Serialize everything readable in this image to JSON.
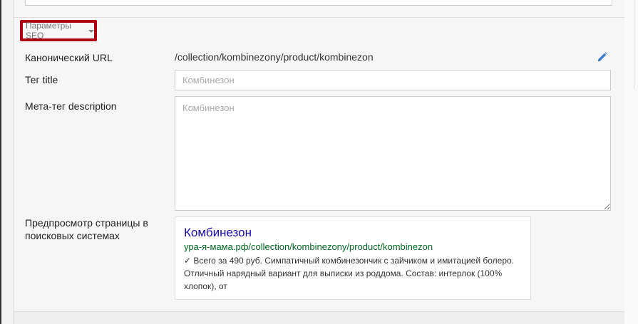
{
  "seo": {
    "toggle_label": "Параметры SEO",
    "canonical_label": "Канонический URL",
    "canonical_value": "/collection/kombinezony/product/kombinezon",
    "title_label": "Тег title",
    "title_placeholder": "Комбинезон",
    "description_label": "Мета-тег description",
    "description_placeholder": "Комбинезон",
    "preview_label": "Предпросмотр страницы в поисковых системах"
  },
  "preview": {
    "title": "Комбинезон",
    "url": "ура-я-мама.рф/collection/kombinezony/product/kombinezon",
    "description": "✓ Всего за 490 руб. Симпатичный комбинезончик с зайчиком и имитацией болеро. Отличный нарядный вариант для выписки из роддома. Состав: интерлок (100% хлопок), от"
  },
  "icons": {
    "edit": "pencil-icon",
    "toggle": "chevron-down-icon"
  },
  "colors": {
    "highlight": "#b10012",
    "link": "#1a0dab",
    "url": "#006621",
    "edit_icon": "#3a7bd5"
  }
}
